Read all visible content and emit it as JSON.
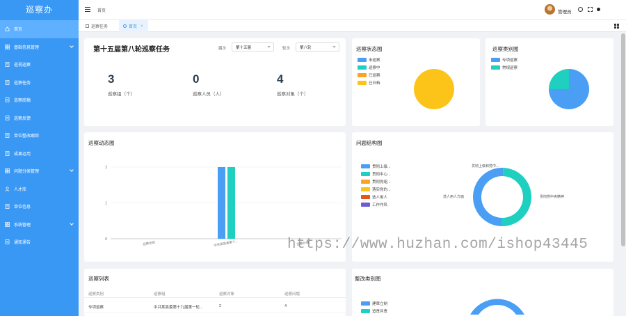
{
  "app_title": "巡察办",
  "sidebar": {
    "items": [
      {
        "label": "首页",
        "icon": "home-icon",
        "active": true,
        "has_children": false
      },
      {
        "label": "基础信息管理",
        "icon": "grid-icon",
        "active": false,
        "has_children": true
      },
      {
        "label": "巡视巡察",
        "icon": "doc-icon",
        "active": false,
        "has_children": false
      },
      {
        "label": "巡察任务",
        "icon": "doc-icon",
        "active": false,
        "has_children": false
      },
      {
        "label": "巡察底稿",
        "icon": "doc-icon",
        "active": false,
        "has_children": false
      },
      {
        "label": "巡察反馈",
        "icon": "doc-icon",
        "active": false,
        "has_children": false
      },
      {
        "label": "单位整改跟踪",
        "icon": "doc-icon",
        "active": false,
        "has_children": false
      },
      {
        "label": "成果运用",
        "icon": "doc-icon",
        "active": false,
        "has_children": false
      },
      {
        "label": "问题分类管理",
        "icon": "grid-icon",
        "active": false,
        "has_children": true
      },
      {
        "label": "人才库",
        "icon": "user-icon",
        "active": false,
        "has_children": false
      },
      {
        "label": "单位信息",
        "icon": "doc-icon",
        "active": false,
        "has_children": false
      },
      {
        "label": "系统管理",
        "icon": "grid-icon",
        "active": false,
        "has_children": true
      },
      {
        "label": "通知通告",
        "icon": "doc-icon",
        "active": false,
        "has_children": false
      }
    ]
  },
  "topbar": {
    "breadcrumb": "首页",
    "user_name": "管理员"
  },
  "tabs": [
    {
      "label": "巡察任务",
      "active": false
    },
    {
      "label": "首页",
      "active": true
    }
  ],
  "task_card": {
    "title": "第十五届第八轮巡察任务",
    "filter1_label": "届次",
    "filter1_value": "第十五届",
    "filter2_label": "轮次",
    "filter2_value": "第八轮",
    "kpis": [
      {
        "value": "3",
        "label": "巡察组（个）"
      },
      {
        "value": "0",
        "label": "巡察人员（人）"
      },
      {
        "value": "4",
        "label": "巡察对象（个）"
      }
    ]
  },
  "status_card": {
    "title": "巡察状态图",
    "legend": [
      {
        "label": "未巡察",
        "color": "#4a9ff5"
      },
      {
        "label": "巡察中",
        "color": "#1fd0c1"
      },
      {
        "label": "已巡察",
        "color": "#f6a623"
      },
      {
        "label": "已归档",
        "color": "#fcc419"
      }
    ]
  },
  "category_card": {
    "title": "巡察类别图",
    "legend": [
      {
        "label": "专项巡察",
        "color": "#4a9ff5"
      },
      {
        "label": "常规巡察",
        "color": "#1fd0c1"
      }
    ]
  },
  "dynamics_card": {
    "title": "巡察动态图"
  },
  "structure_card": {
    "title": "问题结构图",
    "legend": [
      {
        "label": "贯彻上级...",
        "color": "#4a9ff5"
      },
      {
        "label": "贯彻中心...",
        "color": "#1fd0c1"
      },
      {
        "label": "贯彻党组...",
        "color": "#f6a623"
      },
      {
        "label": "落实党的...",
        "color": "#fcc419"
      },
      {
        "label": "选人用人",
        "color": "#e8541e"
      },
      {
        "label": "工作作风",
        "color": "#6c5ccf"
      }
    ],
    "labels": {
      "top": "贯彻上级和党中...",
      "left": "选人用人方面",
      "right": "贯彻党中央精神"
    }
  },
  "list_card": {
    "title": "巡察列表",
    "headers": [
      "巡察类别",
      "巡察组",
      "巡察对象",
      "巡察问题"
    ],
    "rows": [
      [
        "专项巡察",
        "中共某县委第十九届第一轮...",
        "2",
        "4"
      ]
    ]
  },
  "rectify_card": {
    "title": "整改类别图",
    "legend": [
      {
        "label": "建章立制",
        "color": "#4a9ff5"
      },
      {
        "label": "追责问责",
        "color": "#1fd0c1"
      }
    ]
  },
  "watermark": "https://www.huzhan.com/ishop43445",
  "chart_data": [
    {
      "type": "pie",
      "title": "巡察状态图",
      "categories": [
        "未巡察",
        "巡察中",
        "已巡察",
        "已归档"
      ],
      "values": [
        0,
        0,
        0,
        1
      ]
    },
    {
      "type": "pie",
      "title": "巡察类别图",
      "categories": [
        "专项巡察",
        "常规巡察"
      ],
      "values": [
        3,
        1
      ]
    },
    {
      "type": "bar",
      "title": "巡察动态图",
      "categories": [
        "巡察出现",
        "中共某县委第十...",
        "巡察办理"
      ],
      "series": [
        {
          "values": [
            0,
            2,
            0
          ],
          "color": "#4a9ff5"
        },
        {
          "values": [
            0,
            2,
            0
          ],
          "color": "#1fd0c1"
        }
      ],
      "ylim": [
        0,
        2
      ],
      "yticks": [
        0,
        1,
        2
      ]
    },
    {
      "type": "pie",
      "title": "问题结构图",
      "categories": [
        "贯彻上级和党中...",
        "选人用人方面",
        "贯彻党中央精神"
      ],
      "values": [
        0.5,
        50,
        50
      ]
    }
  ]
}
